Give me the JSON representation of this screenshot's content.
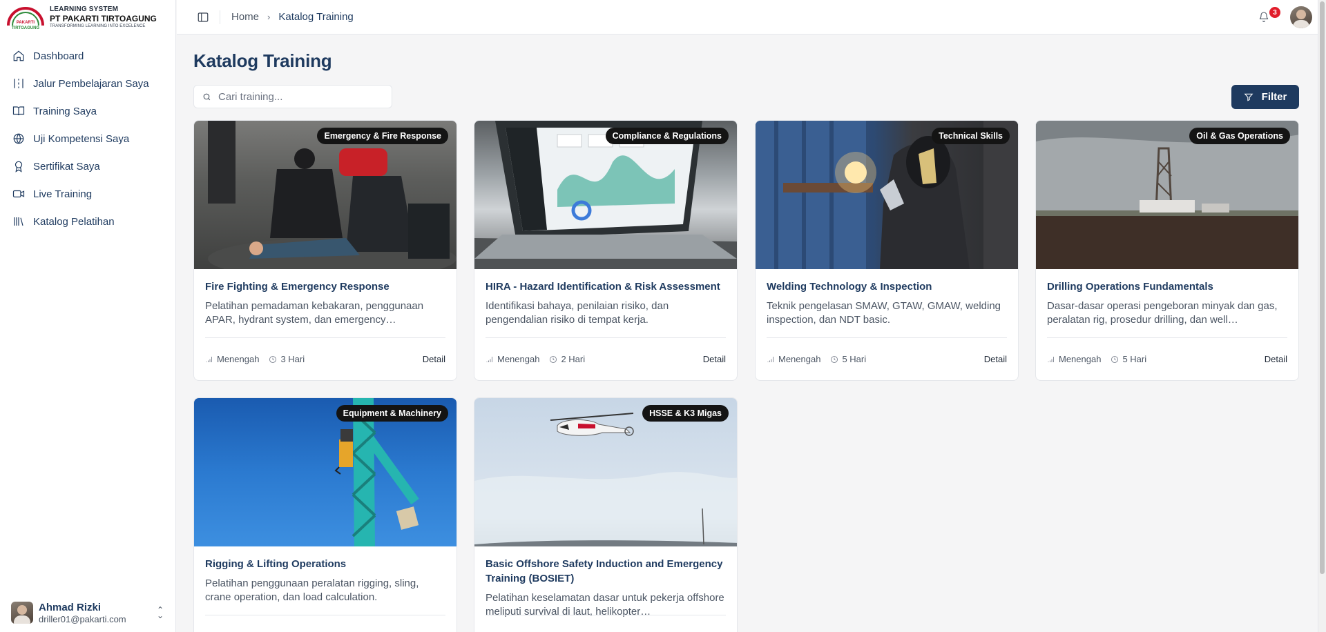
{
  "brand": {
    "line1": "LEARNING SYSTEM",
    "line2": "PT PAKARTI TIRTOAGUNG",
    "line3": "TRANSFORMING LEARNING INTO EXCELENCE",
    "logo_text": "PAKARTI TIRTOAGUNG"
  },
  "sidebar": {
    "items": [
      {
        "label": "Dashboard",
        "icon": "home-icon"
      },
      {
        "label": "Jalur Pembelajaran Saya",
        "icon": "route-icon"
      },
      {
        "label": "Training Saya",
        "icon": "book-open-icon"
      },
      {
        "label": "Uji Kompetensi Saya",
        "icon": "globe-icon"
      },
      {
        "label": "Sertifikat Saya",
        "icon": "award-icon"
      },
      {
        "label": "Live Training",
        "icon": "video-icon"
      },
      {
        "label": "Katalog Pelatihan",
        "icon": "library-icon"
      }
    ]
  },
  "user": {
    "name": "Ahmad Rizki",
    "email": "driller01@pakarti.com"
  },
  "topbar": {
    "breadcrumb": [
      "Home",
      "Katalog Training"
    ],
    "notification_count": "3"
  },
  "main": {
    "title": "Katalog Training",
    "search_placeholder": "Cari training...",
    "filter_label": "Filter"
  },
  "cards": [
    {
      "category": "Emergency & Fire Response",
      "title": "Fire Fighting & Emergency Response",
      "description": "Pelatihan pemadaman kebakaran, penggunaan APAR, hydrant system, dan emergency…",
      "level": "Menengah",
      "duration": "3 Hari",
      "detail": "Detail"
    },
    {
      "category": "Compliance & Regulations",
      "title": "HIRA - Hazard Identification & Risk Assessment",
      "description": "Identifikasi bahaya, penilaian risiko, dan pengendalian risiko di tempat kerja.",
      "level": "Menengah",
      "duration": "2 Hari",
      "detail": "Detail"
    },
    {
      "category": "Technical Skills",
      "title": "Welding Technology & Inspection",
      "description": "Teknik pengelasan SMAW, GTAW, GMAW, welding inspection, dan NDT basic.",
      "level": "Menengah",
      "duration": "5 Hari",
      "detail": "Detail"
    },
    {
      "category": "Oil & Gas Operations",
      "title": "Drilling Operations Fundamentals",
      "description": "Dasar-dasar operasi pengeboran minyak dan gas, peralatan rig, prosedur drilling, dan well…",
      "level": "Menengah",
      "duration": "5 Hari",
      "detail": "Detail"
    },
    {
      "category": "Equipment & Machinery",
      "title": "Rigging & Lifting Operations",
      "description": "Pelatihan penggunaan peralatan rigging, sling, crane operation, dan load calculation.",
      "level": "",
      "duration": "",
      "detail": ""
    },
    {
      "category": "HSSE & K3 Migas",
      "title": "Basic Offshore Safety Induction and Emergency Training (BOSIET)",
      "description": "Pelatihan keselamatan dasar untuk pekerja offshore meliputi survival di laut, helikopter…",
      "level": "",
      "duration": "",
      "detail": ""
    }
  ],
  "colors": {
    "primary": "#1e3a5f",
    "badge_red": "#e11d2b",
    "category_chip": "#141414"
  }
}
